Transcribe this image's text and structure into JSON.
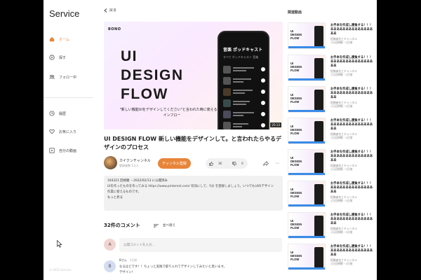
{
  "sidebar": {
    "brand": "Service",
    "nav": [
      {
        "label": "ホーム",
        "icon": "home-icon",
        "active": true
      },
      {
        "label": "探す",
        "icon": "compass-icon",
        "active": false
      },
      {
        "label": "フォロー中",
        "icon": "people-icon",
        "active": false
      }
    ],
    "nav2": [
      {
        "label": "履歴",
        "icon": "clock-icon"
      },
      {
        "label": "お気に入り",
        "icon": "heart-icon"
      },
      {
        "label": "自分の動画",
        "icon": "video-icon"
      }
    ],
    "footer": "© 2022 Service"
  },
  "main": {
    "back_label": "戻る",
    "thumbnail": {
      "logo": "BONO",
      "big_title_lines": [
        "UI",
        "DESIGN",
        "FLOW"
      ],
      "subtitle": "\"新しい機能UIをデザインしてください\"と言われた時に使えるデザインフロー",
      "duration": "25:13",
      "phone_header": "音楽  ポッドキャスト",
      "phone_tabs": "すべて   ポッドキャスト   音楽"
    },
    "video_title": "UI DESIGN FLOW 新しい機能をデザインして。と言われたらやるデザインのプロセス",
    "channel": {
      "name": "カイクンチャンネル",
      "subscribers": "登録者数 1万人"
    },
    "subscribe_label": "チャンネル登録",
    "like_count": "1K",
    "dislike_count": "0",
    "description_lines": [
      "104321 回視聴 ・2022/02/13 に公開済み",
      "UIを作ったものを作ってみる https://www.pinterest.com/ 有効にして、5分 を登録しましょう。いつでもUIのデザイン",
      "作業に使えるものです。",
      "もっと見る"
    ],
    "comments": {
      "heading": "32件のコメント",
      "sort_label": "並べ替え",
      "input_placeholder": "公開コメントを入力...",
      "input_avatar": "A",
      "first": {
        "avatar": "B",
        "author": "Bさん",
        "time": "1日前",
        "text_lines": [
          "なるほどです！！ちょっと実践で取り入れてデザインしてみたいと思います。",
          "デザイン！"
        ]
      }
    }
  },
  "related": {
    "heading": "関連動画",
    "items": [
      {
        "title": "お手本を作成し勝負する！！！ああああああああああああああああ",
        "channel": "投稿者名とチャンネル",
        "meta": "1万回視聴・2日前"
      },
      {
        "title": "お手本を作成し勝負する！！！ああああああああああああああああ",
        "channel": "投稿者名とチャンネル",
        "meta": "1万回視聴・2日前"
      },
      {
        "title": "お手本を作成し勝負する！！！ああああああああああああああああ",
        "channel": "投稿者名とチャンネル",
        "meta": "1万回視聴・2日前"
      },
      {
        "title": "お手本を作成し勝負する！！！ああああああああああああああああ",
        "channel": "投稿者名とチャンネル",
        "meta": "1万回視聴・2日前"
      },
      {
        "title": "お手本を作成し勝負する！！！ああああああああああああああああ",
        "channel": "投稿者名とチャンネル",
        "meta": "1万回視聴・2日前"
      },
      {
        "title": "お手本を作成し勝負する！！！ああああああああああああああああ",
        "channel": "投稿者名とチャンネル",
        "meta": "1万回視聴・2日前"
      },
      {
        "title": "お手本を作成し勝負する！！！ああああああああああああああああ",
        "channel": "投稿者名とチャンネル",
        "meta": "1万回視聴・2日前"
      },
      {
        "title": "お手本を作成し勝負する！！！ああああああああああああああああ",
        "channel": "投稿者名とチャンネル",
        "meta": "1万回視聴・2日前"
      }
    ],
    "thumb_title_lines": [
      "UI",
      "DESIGN",
      "FLOW"
    ]
  },
  "colors": {
    "accent": "#e8853a",
    "background_outer": "#000000",
    "panel": "#f1f1f1"
  }
}
